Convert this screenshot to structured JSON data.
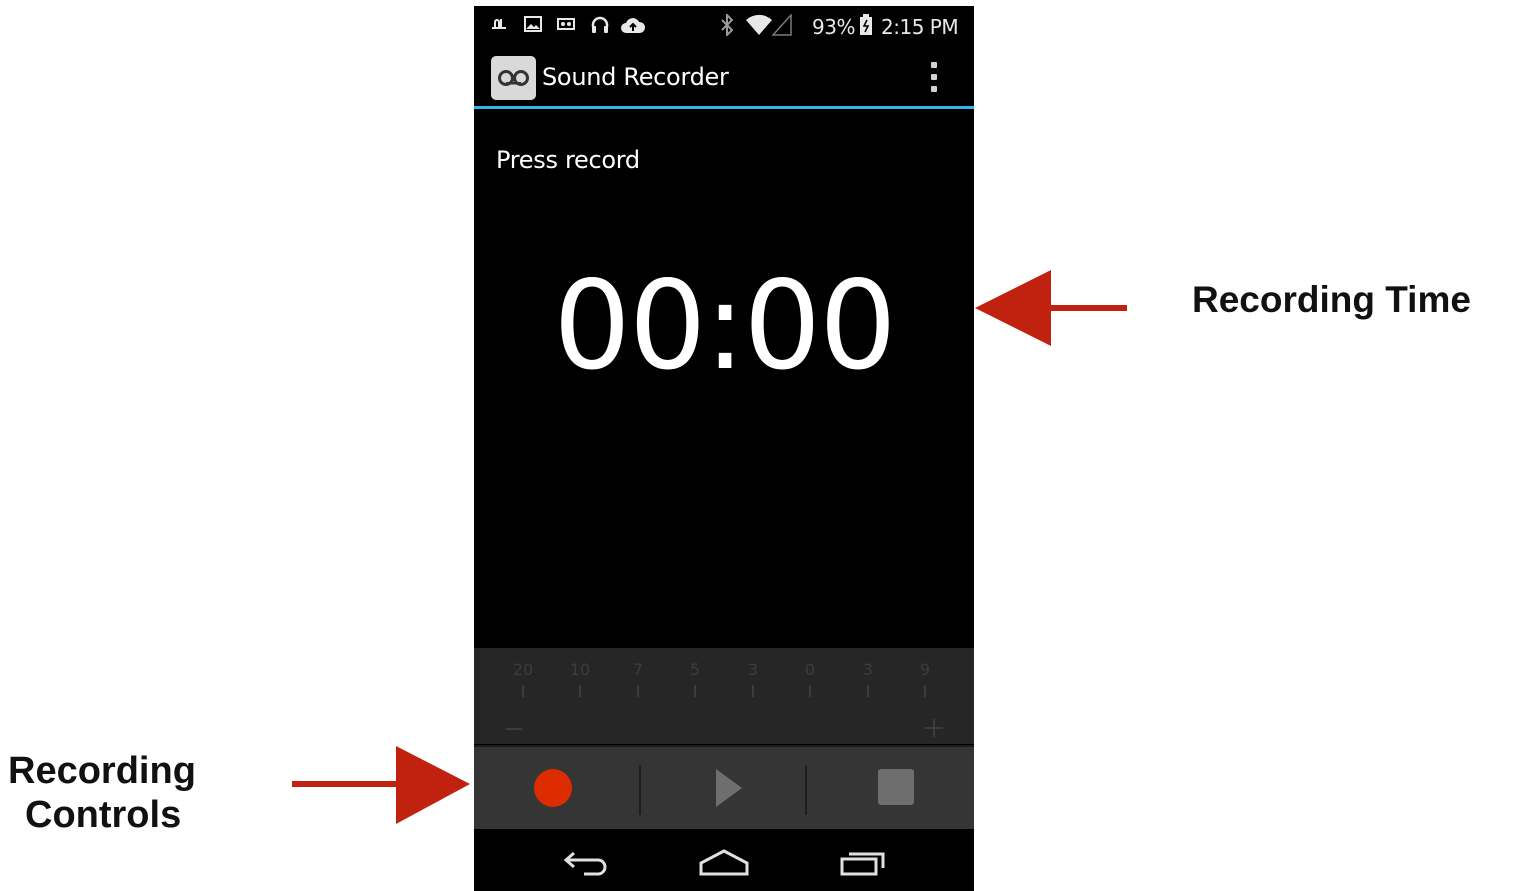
{
  "status_bar": {
    "battery": "93%",
    "time": "2:15 PM",
    "icons": [
      "usb-icon",
      "image-icon",
      "voicemail-icon",
      "headset-icon",
      "cloud-upload-icon",
      "bluetooth-icon",
      "wifi-icon",
      "signal-icon",
      "battery-icon"
    ]
  },
  "app": {
    "title": "Sound Recorder",
    "icon": "recorder-icon",
    "menu_icon": "overflow-menu-icon"
  },
  "main": {
    "status_message": "Press record",
    "timer": "00:00"
  },
  "vu_meter": {
    "scale_labels": [
      "20",
      "10",
      "7",
      "5",
      "3",
      "0",
      "3",
      "9"
    ],
    "minus": "−",
    "plus": "+"
  },
  "controls": {
    "record": "record-icon",
    "play": "play-icon",
    "stop": "stop-icon",
    "colors": {
      "record": "#dd2c00",
      "disabled": "#6e6e6e"
    }
  },
  "nav_bar": [
    "back-icon",
    "home-icon",
    "recent-apps-icon"
  ],
  "annotations": {
    "recording_time": "Recording Time",
    "recording_controls_line1": "Recording",
    "recording_controls_line2": "Controls",
    "arrow_color": "#c0220f"
  },
  "colors": {
    "accent": "#33b5e5",
    "background": "#000000"
  }
}
